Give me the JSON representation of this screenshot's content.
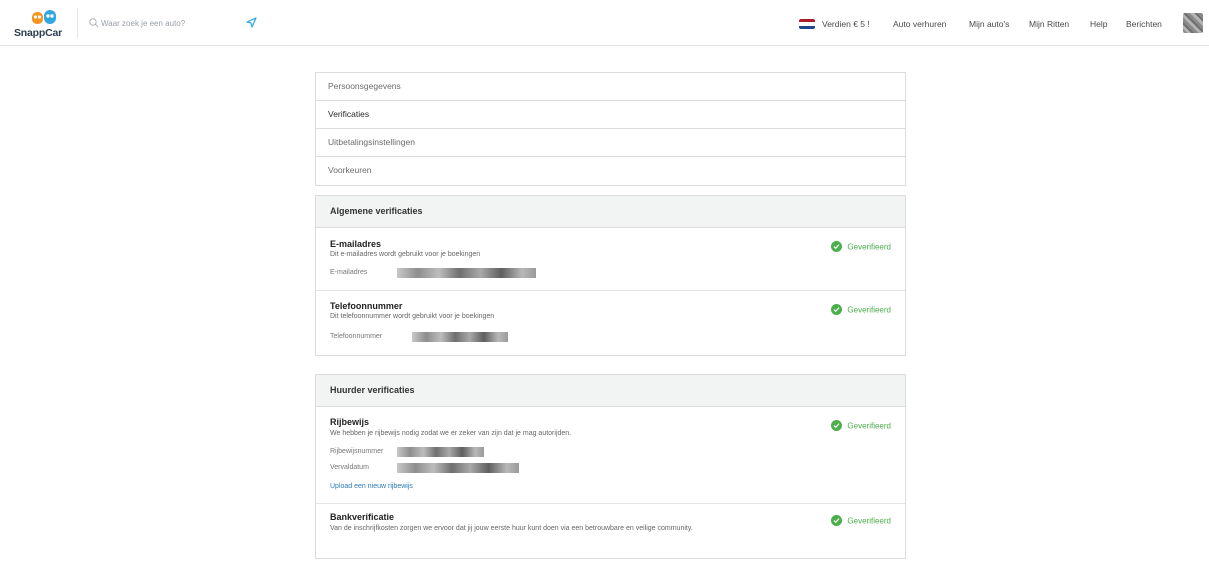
{
  "header": {
    "brand": "SnappCar",
    "search_placeholder": "Waar zoek je een auto?",
    "nav": {
      "earn": "Verdien € 5 !",
      "rent_out": "Auto verhuren",
      "my_cars": "Mijn auto's",
      "my_trips": "Mijn Ritten",
      "help": "Help",
      "messages": "Berichten"
    },
    "flag_colors": [
      "#ae1c28",
      "#ffffff",
      "#21468b"
    ]
  },
  "menu": {
    "items": [
      {
        "label": "Persoonsgegevens"
      },
      {
        "label": "Verificaties"
      },
      {
        "label": "Uitbetalingsinstellingen"
      },
      {
        "label": "Voorkeuren"
      }
    ],
    "active": "Verificaties"
  },
  "general": {
    "title": "Algemene verificaties",
    "email": {
      "title": "E-mailadres",
      "desc": "Dit e-mailadres wordt gebruikt voor je boekingen",
      "field_label": "E-mailadres",
      "status": "Geverifieerd"
    },
    "phone": {
      "title": "Telefoonnummer",
      "desc": "Dit telefoonnummer wordt gebruikt voor je boekingen",
      "field_label": "Telefoonnummer",
      "status": "Geverifieerd"
    }
  },
  "renter": {
    "title": "Huurder verificaties",
    "license": {
      "title": "Rijbewijs",
      "desc": "We hebben je rijbewijs nodig zodat we er zeker van zijn dat je mag autorijden.",
      "number_label": "Rijbewijsnummer",
      "expiry_label": "Vervaldatum",
      "upload_link": "Upload een nieuw rijbewijs",
      "status": "Geverifieerd"
    },
    "bank": {
      "title": "Bankverificatie",
      "desc": "Van de inschrijfkosten zorgen we ervoor dat jij jouw eerste huur kunt doen via een betrouwbare en veilige community.",
      "status": "Geverifieerd"
    }
  },
  "colors": {
    "verified_green": "#4cae4c",
    "link_blue": "#2a7ab9",
    "brand_orange": "#f7941d",
    "brand_blue": "#2fa8e0"
  }
}
